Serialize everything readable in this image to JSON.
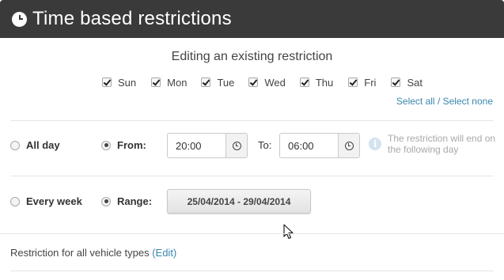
{
  "window": {
    "title": "Time based restrictions",
    "icon": "clock-icon"
  },
  "subtitle": "Editing an existing restriction",
  "days": [
    {
      "label": "Sun",
      "checked": true
    },
    {
      "label": "Mon",
      "checked": true
    },
    {
      "label": "Tue",
      "checked": true
    },
    {
      "label": "Wed",
      "checked": true
    },
    {
      "label": "Thu",
      "checked": true
    },
    {
      "label": "Fri",
      "checked": true
    },
    {
      "label": "Sat",
      "checked": true
    }
  ],
  "select_links": {
    "select_all": "Select all",
    "separator": "/",
    "select_none": "Select none"
  },
  "time_options": {
    "all_day_label": "All day",
    "all_day_selected": false,
    "from_label": "From:",
    "from_selected": true,
    "from_value": "20:00",
    "to_label": "To:",
    "to_value": "06:00",
    "info_text": "The restriction will end on the following day"
  },
  "date_options": {
    "every_week_label": "Every week",
    "every_week_selected": false,
    "range_label": "Range:",
    "range_selected": true,
    "range_value": "25/04/2014 - 29/04/2014"
  },
  "vehicle": {
    "text": "Restriction for all vehicle types",
    "edit_label": "(Edit)"
  },
  "colors": {
    "titlebar": "#3a3a3a",
    "link": "#3a87ad",
    "info": "#a9a9a9"
  }
}
